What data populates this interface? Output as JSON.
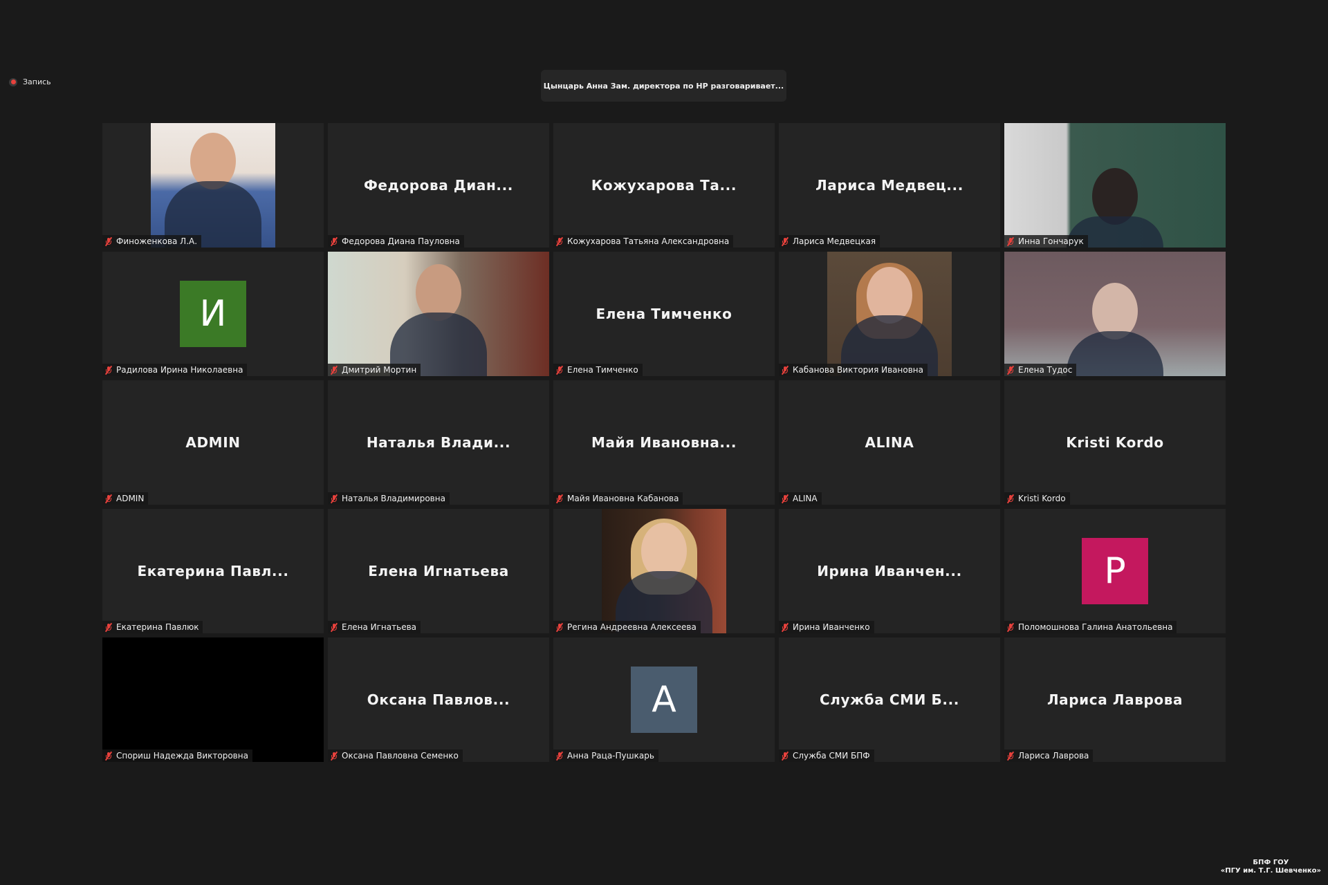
{
  "recording": {
    "label": "Запись",
    "icon": "recording-dot-icon",
    "dot_color": "#e8413c"
  },
  "speaker_banner": {
    "text": "Цынцарь Анна Зам. директора по НР разговаривает..."
  },
  "tiles": [
    {
      "display": "",
      "label": "Финоженкова Л.А.",
      "kind": "photo"
    },
    {
      "display": "Федорова  Диан...",
      "label": "Федорова Диана Пауловна",
      "kind": "name"
    },
    {
      "display": "Кожухарова  Та...",
      "label": "Кожухарова Татьяна Александровна",
      "kind": "name"
    },
    {
      "display": "Лариса  Медвец...",
      "label": "Лариса Медвецкая",
      "kind": "name"
    },
    {
      "display": "",
      "label": "Инна Гончарук",
      "kind": "video"
    },
    {
      "display": "И",
      "label": "Радилова Ирина Николаевна",
      "kind": "avatar",
      "color": "#3b7a26"
    },
    {
      "display": "",
      "label": "Дмитрий Мортин",
      "kind": "video"
    },
    {
      "display": "Елена Тимченко",
      "label": "Елена Тимченко",
      "kind": "name"
    },
    {
      "display": "",
      "label": "Кабанова Виктория Ивановна",
      "kind": "photo"
    },
    {
      "display": "",
      "label": "Елена Тудос",
      "kind": "video"
    },
    {
      "display": "ADMIN",
      "label": "ADMIN",
      "kind": "name"
    },
    {
      "display": "Наталья  Влади...",
      "label": "Наталья Владимировна",
      "kind": "name"
    },
    {
      "display": "Майя  Ивановна...",
      "label": "Майя Ивановна Кабанова",
      "kind": "name"
    },
    {
      "display": "ALINA",
      "label": "ALINA",
      "kind": "name"
    },
    {
      "display": "Kristi Kordo",
      "label": "Kristi Kordo",
      "kind": "name"
    },
    {
      "display": "Екатерина  Павл...",
      "label": "Екатерина Павлюк",
      "kind": "name"
    },
    {
      "display": "Елена Игнатьева",
      "label": "Елена Игнатьева",
      "kind": "name"
    },
    {
      "display": "",
      "label": "Регина Андреевна Алексеева",
      "kind": "photo"
    },
    {
      "display": "Ирина  Иванчен...",
      "label": "Ирина Иванченко",
      "kind": "name"
    },
    {
      "display": "Р",
      "label": "Поломошнова Галина Анатольевна",
      "kind": "avatar",
      "color": "#c4185e"
    },
    {
      "display": "",
      "label": "Спориш Надежда Викторовна",
      "kind": "black"
    },
    {
      "display": "Оксана  Павлов...",
      "label": "Оксана Павловна Семенко",
      "kind": "name"
    },
    {
      "display": "A",
      "label": "Анна Раца-Пушкарь",
      "kind": "avatar",
      "color": "#4a5c6e"
    },
    {
      "display": "Служба  СМИ  Б...",
      "label": "Служба СМИ БПФ",
      "kind": "name"
    },
    {
      "display": "Лариса Лаврова",
      "label": "Лариса Лаврова",
      "kind": "name"
    }
  ],
  "footer": {
    "line1": "БПФ ГОУ",
    "line2": "«ПГУ им. Т.Г. Шевченко»"
  },
  "colors": {
    "background": "#1a1a1a",
    "tile": "#242424",
    "muted_mic": "#e8413c"
  }
}
